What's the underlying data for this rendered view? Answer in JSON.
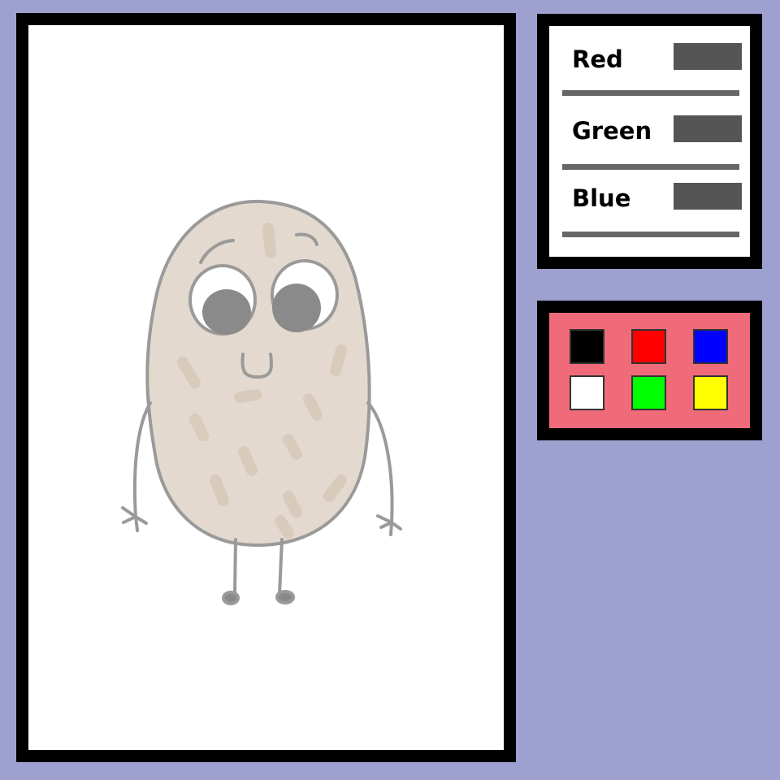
{
  "sliders": {
    "items": [
      {
        "label": "Red"
      },
      {
        "label": "Green"
      },
      {
        "label": "Blue"
      }
    ]
  },
  "palette": {
    "swatches": [
      {
        "name": "black",
        "color": "#000000"
      },
      {
        "name": "red",
        "color": "#ff0000"
      },
      {
        "name": "blue",
        "color": "#0000ff"
      },
      {
        "name": "white",
        "color": "#ffffff"
      },
      {
        "name": "green",
        "color": "#00ff00"
      },
      {
        "name": "yellow",
        "color": "#ffff00"
      }
    ]
  },
  "colors": {
    "background": "#9ea0cf",
    "frame": "#000000",
    "canvas": "#ffffff",
    "palette_bg": "#f06b7a",
    "slider_handle": "#555555",
    "slider_track": "#666666",
    "drawing_fill": "#e3d9ce",
    "drawing_stroke": "#9a9a9a",
    "pupil": "#8a8a8a"
  }
}
